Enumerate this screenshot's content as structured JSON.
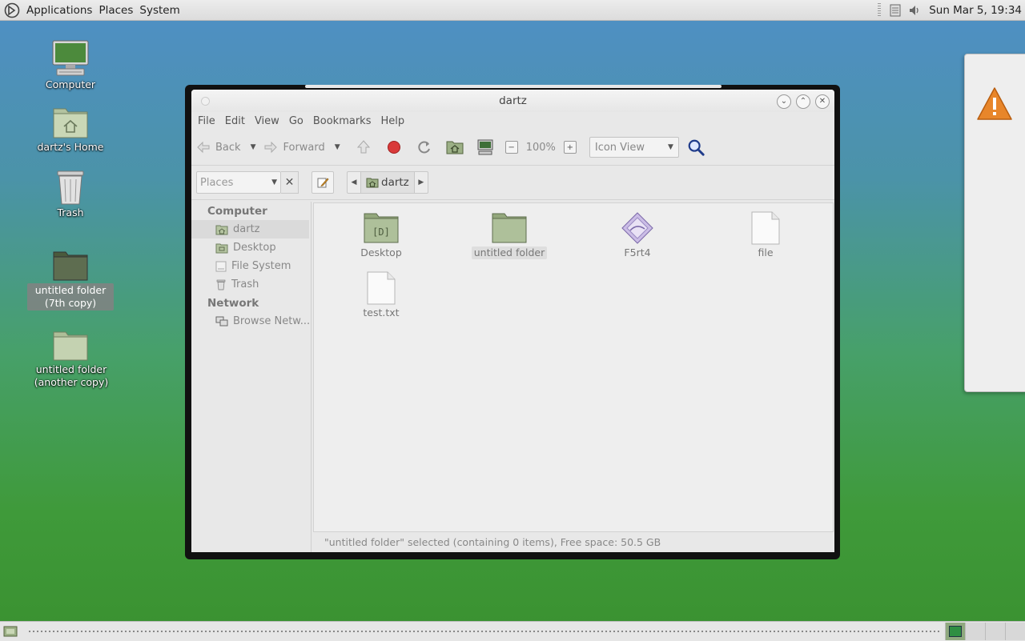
{
  "top_panel": {
    "menus": [
      "Applications",
      "Places",
      "System"
    ],
    "clock": "Sun Mar 5, 19:34",
    "icons": [
      "distro-logo-icon",
      "clipboard-icon",
      "volume-icon"
    ]
  },
  "desktop": {
    "icons": [
      {
        "label": "Computer",
        "icon": "computer-icon"
      },
      {
        "label": "dartz's Home",
        "icon": "home-folder-icon"
      },
      {
        "label": "Trash",
        "icon": "trash-icon"
      },
      {
        "label": "untitled folder (7th copy)",
        "icon": "folder-icon",
        "selected": true
      },
      {
        "label": "untitled folder (another copy)",
        "icon": "folder-icon"
      }
    ]
  },
  "window": {
    "title": "dartz",
    "menubar": [
      "File",
      "Edit",
      "View",
      "Go",
      "Bookmarks",
      "Help"
    ],
    "toolbar": {
      "back": "Back",
      "forward": "Forward",
      "zoom": "100%",
      "view_mode": "Icon View"
    },
    "location": {
      "side_pane": "Places",
      "breadcrumb": "dartz"
    },
    "sidebar": {
      "computer_heading": "Computer",
      "computer_items": [
        "dartz",
        "Desktop",
        "File System",
        "Trash"
      ],
      "network_heading": "Network",
      "network_items": [
        "Browse Netw..."
      ]
    },
    "files": [
      {
        "label": "Desktop",
        "type": "folder-desktop"
      },
      {
        "label": "untitled folder",
        "type": "folder",
        "selected": true
      },
      {
        "label": "F5rt4",
        "type": "image"
      },
      {
        "label": "file",
        "type": "document"
      },
      {
        "label": "test.txt",
        "type": "text"
      }
    ],
    "status": "\"untitled folder\" selected (containing 0 items), Free space: 50.5 GB"
  },
  "colors": {
    "folder_green": "#9cb086",
    "folder_dark": "#5b6a4d",
    "desktop_top": "#4f8fc6",
    "desktop_bottom": "#3a9130",
    "warning": "#e8862a"
  }
}
